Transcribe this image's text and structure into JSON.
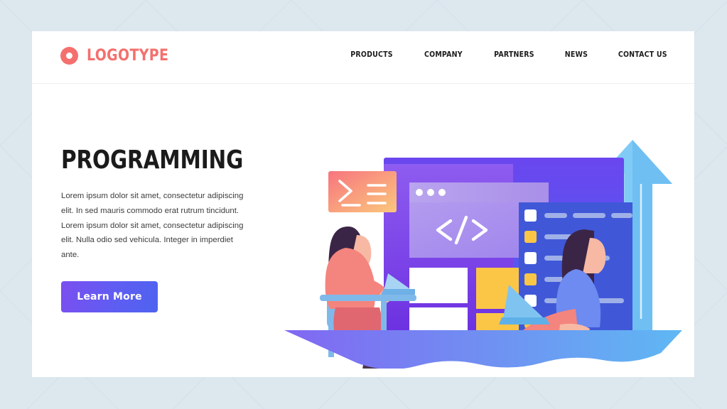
{
  "page": {
    "background_color": "#dde7ee",
    "card_color": "#ffffff"
  },
  "header": {
    "logo": {
      "icon": "ring-logo-icon",
      "text": "LOGOTYPE",
      "color": "#f4706e"
    },
    "nav_items": [
      {
        "label": "PRODUCTS"
      },
      {
        "label": "COMPANY"
      },
      {
        "label": "PARTNERS"
      },
      {
        "label": "NEWS"
      },
      {
        "label": "CONTACT US"
      }
    ]
  },
  "hero": {
    "title": "PROGRAMMING",
    "body": "Lorem ipsum dolor sit amet, consectetur adipiscing elit. In sed mauris commodo erat rutrum tincidunt. Lorem ipsum dolor sit amet, consectetur adipiscing elit. Nulla  odio sed vehicula. Integer in imperdiet ante.",
    "cta_label": "Learn More",
    "cta_gradient_from": "#7b4ff0",
    "cta_gradient_to": "#4f63ef"
  },
  "illustration": {
    "name": "programming-workspace-illustration",
    "terminal_card": {
      "prompt_symbol": ">",
      "gradient_from": "#f77a85",
      "gradient_to": "#fbc379"
    },
    "code_symbol": "</>",
    "browser_window": {
      "dots": 3,
      "dot_color": "#ffffff",
      "titlebar_color": "#a98fe8"
    },
    "monitor": {
      "camera_dot_color": "#ffffff",
      "frame_color": "#5b4ae4"
    },
    "editor_rows": [
      {
        "checkbox": "#ffffff",
        "bars": [
          32,
          46,
          30
        ]
      },
      {
        "checkbox": "#fbc646",
        "bars": [
          68
        ]
      },
      {
        "checkbox": "#ffffff",
        "bars": [
          30,
          52
        ]
      },
      {
        "checkbox": "#fbc646",
        "bars": [
          58
        ]
      },
      {
        "checkbox": "#ffffff",
        "bars": [
          52,
          50
        ]
      },
      {
        "checkbox": "#fbc646",
        "bars": [
          66
        ]
      }
    ],
    "arrow": {
      "direction": "up",
      "color": "#7cc8f5"
    },
    "ground_wave": {
      "gradient_from": "#7b63f0",
      "gradient_to": "#5fb8f2"
    },
    "accent_colors": {
      "yellow": "#fbc646",
      "coral": "#f4847e",
      "skin": "#f7a48f",
      "hair": "#3b2546",
      "chair_blue": "#7fb9ea",
      "panel_purple": "#6b3fe0",
      "editor_blue": "#4058d8"
    }
  }
}
